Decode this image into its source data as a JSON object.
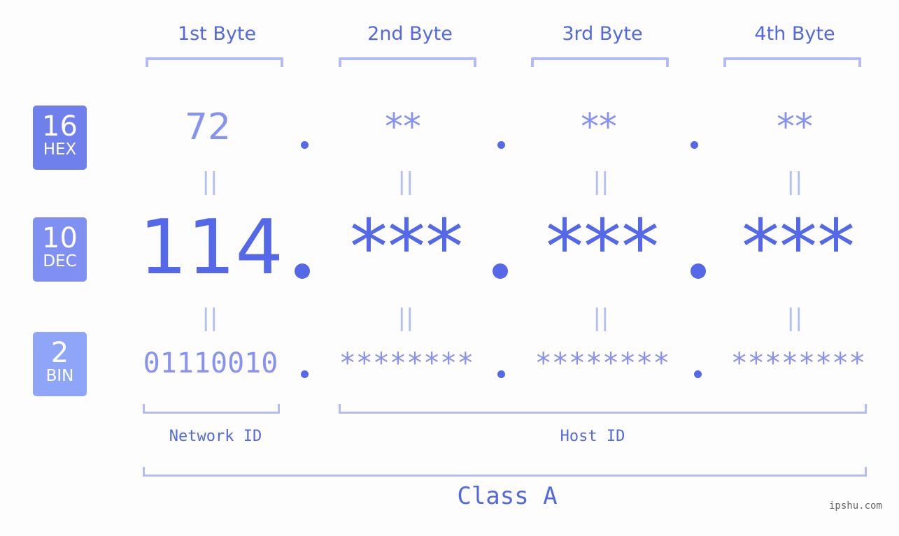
{
  "byte_headers": [
    "1st Byte",
    "2nd Byte",
    "3rd Byte",
    "4th Byte"
  ],
  "badges": [
    {
      "num": "16",
      "sub": "HEX",
      "color": "#6f7feb"
    },
    {
      "num": "10",
      "sub": "DEC",
      "color": "#8090f2"
    },
    {
      "num": "2",
      "sub": "BIN",
      "color": "#8fa6f8"
    }
  ],
  "hex": [
    "72",
    "**",
    "**",
    "**"
  ],
  "dec": [
    "114",
    "***",
    "***",
    "***"
  ],
  "bin": [
    "01110010",
    "********",
    "********",
    "********"
  ],
  "equals_symbol": "||",
  "network_id_label": "Network ID",
  "host_id_label": "Host ID",
  "class_label": "Class A",
  "watermark": "ipshu.com",
  "colors": {
    "accent": "#5468e8",
    "light_accent": "#8892ef",
    "bracket": "#b3bcf7"
  }
}
